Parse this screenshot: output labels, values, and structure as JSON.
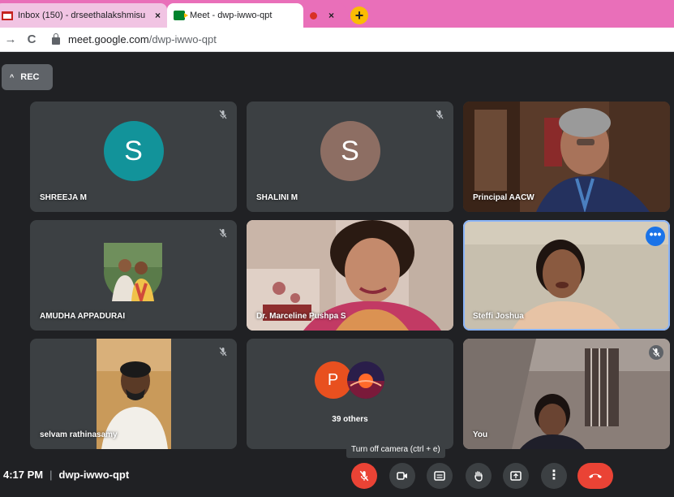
{
  "browser": {
    "tabs": [
      {
        "label": "Inbox (150) - drseethalakshmisu",
        "close": "×",
        "icon": "gmail-icon"
      },
      {
        "label": "Meet - dwp-iwwo-qpt",
        "icon": "meet-icon"
      },
      {
        "label": "",
        "close": "×",
        "icon": "recording-dot-icon"
      }
    ],
    "new_tab": "+",
    "nav": {
      "back": "→",
      "reload": "C"
    },
    "address": {
      "host": "meet.google.com",
      "path": "/dwp-iwwo-qpt"
    }
  },
  "recording": {
    "label": "REC",
    "caret": "^"
  },
  "participants": [
    {
      "name": "SHREEJA M",
      "initial": "S",
      "avatar_color": "#12939a",
      "type": "avatar",
      "muted": true
    },
    {
      "name": "SHALINI M",
      "initial": "S",
      "avatar_color": "#8d6e63",
      "type": "avatar",
      "muted": true
    },
    {
      "name": "Principal AACW",
      "type": "video",
      "muted": false
    },
    {
      "name": "AMUDHA APPADURAI",
      "type": "photo",
      "muted": true
    },
    {
      "name": "Dr. Marceline Pushpa S",
      "type": "video",
      "muted": false
    },
    {
      "name": "Steffi Joshua",
      "type": "video",
      "muted": false,
      "active": true
    },
    {
      "name": "selvam rathinasamy",
      "type": "video",
      "muted": true
    },
    {
      "name": "39 others",
      "type": "group",
      "initial": "P",
      "avatar_color": "#e8501f"
    },
    {
      "name": "You",
      "type": "video",
      "muted": true
    }
  ],
  "tooltip": "Turn off camera (ctrl + e)",
  "meeting": {
    "time": "4:17 PM",
    "separator": "|",
    "code": "dwp-iwwo-qpt"
  },
  "controls": [
    {
      "name": "mic-toggle",
      "icon": "mic-off-icon"
    },
    {
      "name": "camera-toggle",
      "icon": "camera-icon"
    },
    {
      "name": "captions",
      "icon": "captions-icon"
    },
    {
      "name": "raise-hand",
      "icon": "hand-icon"
    },
    {
      "name": "present",
      "icon": "present-icon"
    },
    {
      "name": "more-options",
      "icon": "more-vert-icon"
    },
    {
      "name": "leave-call",
      "icon": "end-call-icon"
    }
  ],
  "glyphs": {
    "mute": "✕̸",
    "more": "•••",
    "vert": "⋮"
  }
}
